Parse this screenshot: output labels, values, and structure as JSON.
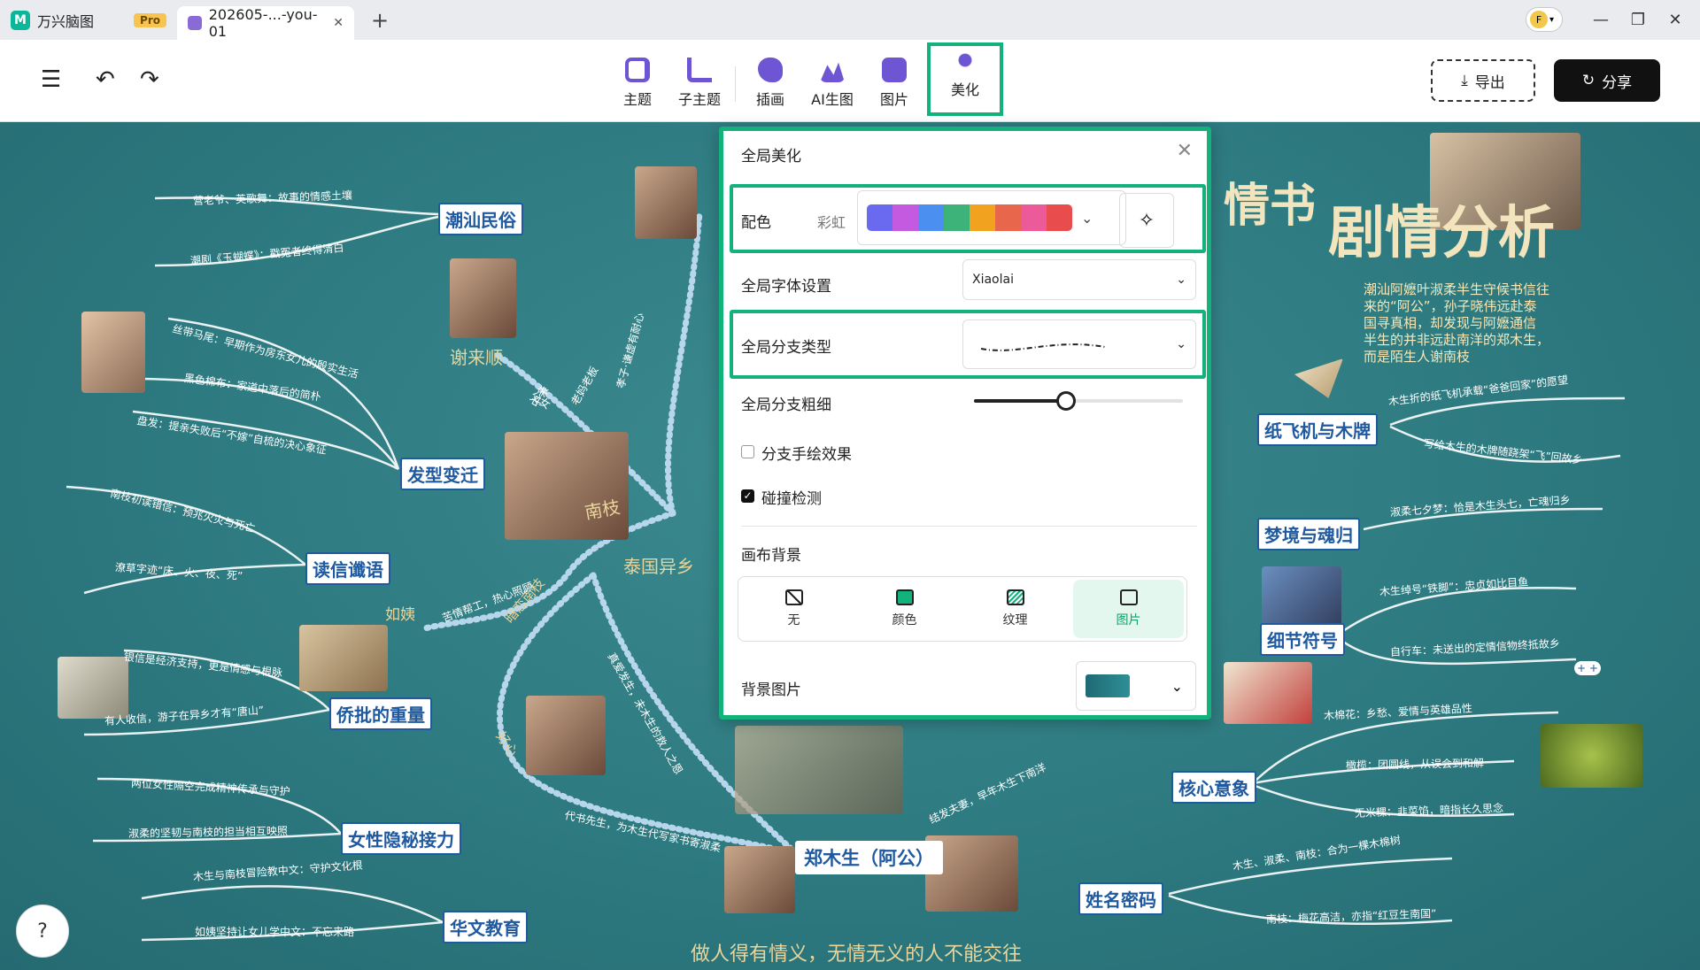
{
  "titlebar": {
    "app_name": "万兴脑图",
    "pro_badge": "Pro",
    "doc_tab": "202605-...-you-01",
    "doc_close": "✕",
    "new_tab": "+",
    "avatar_letter": "F"
  },
  "toolbar": {
    "tools": [
      {
        "label": "主题",
        "color": "#7a5ad6"
      },
      {
        "label": "子主题",
        "color": "#7a5ad6"
      },
      {
        "label": "插画",
        "color": "#7a5ad6"
      },
      {
        "label": "AI生图",
        "color": "#7a5ad6"
      },
      {
        "label": "图片",
        "color": "#7a5ad6"
      },
      {
        "label": "美化",
        "color": "#7a5ad6"
      }
    ],
    "export_label": "导出",
    "share_label": "分享"
  },
  "panel": {
    "title": "全局美化",
    "color_label": "配色",
    "color_scheme": "彩虹",
    "swatches": [
      "#6a6af0",
      "#c45ae0",
      "#4b8ff0",
      "#3db37a",
      "#f1a21e",
      "#e8664c",
      "#ec5a9a",
      "#e84c4c"
    ],
    "font_label": "全局字体设置",
    "font_value": "Xiaolai",
    "branch_type_label": "全局分支类型",
    "branch_width_label": "全局分支粗细",
    "branch_width_value": 0.44,
    "hand_drawn_label": "分支手绘效果",
    "hand_drawn": false,
    "collision_label": "碰撞检测",
    "collision": true,
    "canvas_bg_label": "画布背景",
    "bg_options": [
      "无",
      "颜色",
      "纹理",
      "图片"
    ],
    "bg_selected": "图片",
    "bg_image_label": "背景图片"
  },
  "mindmap": {
    "center": "郑木生（阿公）",
    "title_main": "剧情分析",
    "title_left": "情书",
    "description": [
      "潮汕阿嬷叶淑柔半生守候书信往",
      "来的“阿公”，孙子晓伟远赴泰",
      "国寻真相，却发现与阿嬷通信",
      "半生的并非远赴南洋的郑木生，",
      "而是陌生人谢南枝"
    ],
    "bottom_quote": "做人得有情义，无情无义的人不能交往",
    "topics": {
      "chaoshan": "潮汕民俗",
      "hair": "发型变迁",
      "letter": "读信谶语",
      "remit": "侨批的重量",
      "women": "女性隐秘接力",
      "edu": "华文教育",
      "plane": "纸飞机与木牌",
      "dream": "梦境与魂归",
      "detail": "细节符号",
      "core": "核心意象",
      "name": "姓名密码"
    },
    "leaves": {
      "chaoshan_1": "营老爷、英歌舞：故事的情感土壤",
      "chaoshan_2": "潮剧《玉蝴蝶》：戳冤者终得清白",
      "hair_1": "丝带马尾：早期作为房东女儿的殷实生活",
      "hair_2": "黑色棉布：家道中落后的简朴",
      "hair_3": "盘发：提亲失败后“不嫁”自梳的决心象征",
      "letter_1": "南枝初读错信：预兆火灾与死亡",
      "letter_2": "潦草字迹“床、火、夜、死”",
      "remit_1": "银信是经济支持，更是情感与根脉",
      "remit_2": "有人收信，游子在异乡才有“唐山”",
      "women_1": "两位女性隔空完成精神传承与守护",
      "women_2": "淑柔的坚韧与南枝的担当相互映照",
      "edu_1": "木生与南枝冒险教中文：守护文化根",
      "edu_2": "如姨坚持让女儿学中文：不忘来路",
      "plane_1": "木生折的纸飞机承载“爸爸回家”的愿望",
      "plane_2": "写给木生的木牌随跷架“飞”回故乡",
      "dream_1": "淑柔七夕梦：恰是木生头七，亡魂归乡",
      "detail_1": "木生绰号“铁脚”：忠贞如比目鱼",
      "detail_2": "自行车：未送出的定情信物终抵故乡",
      "core_1": "木棉花：乡愁、爱情与英雄品性",
      "core_2": "橄榄：团圆线，从误会到和解",
      "core_3": "无米粿：韭菜馅，暗指长久思念",
      "name_1": "木生、淑柔、南枝：合为一棵木棉树",
      "name_2": "南枝：梅花高洁，亦指“红豆生南国”"
    },
    "gold_labels": {
      "xie": "谢来顺",
      "nanzhi": "南枝",
      "thai": "泰国异乡",
      "ruyi": "如姨",
      "anlian": "暗恋南枝",
      "zhonglian": "中亲",
      "haoxin": "好心"
    },
    "branch_labels": {
      "b1": "父女",
      "b2": "老妈老板",
      "b3": "孝子·谦虚有耐心",
      "b4": "苦情帮工，热心照顾",
      "b5": "暗恋南枝",
      "b6": "代书先生，为木生代写家书寄淑柔",
      "b7": "结发夫妻，早年木生下南洋",
      "b8": "真爱发生，未木生的救人之恩"
    }
  }
}
